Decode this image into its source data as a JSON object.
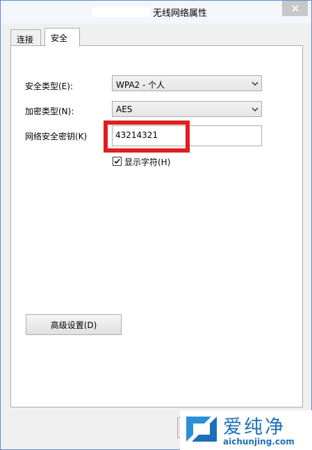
{
  "window": {
    "title": "无线网络属性"
  },
  "tabs": [
    {
      "label": "连接"
    },
    {
      "label": "安全"
    }
  ],
  "security": {
    "type_label": "安全类型(E):",
    "type_value": "WPA2 - 个人",
    "encryption_label": "加密类型(N):",
    "encryption_value": "AES",
    "key_label": "网络安全密钥(K)",
    "key_value": "43214321",
    "show_chars_label": "显示字符(H)",
    "show_chars_checked": true,
    "advanced_button": "高级设置(D)"
  },
  "watermark": {
    "name": "爱纯净",
    "url": "aichunjing.com"
  },
  "colors": {
    "highlight": "#e01e1e",
    "brand": "#1c6fb8",
    "border": "#adadad"
  }
}
